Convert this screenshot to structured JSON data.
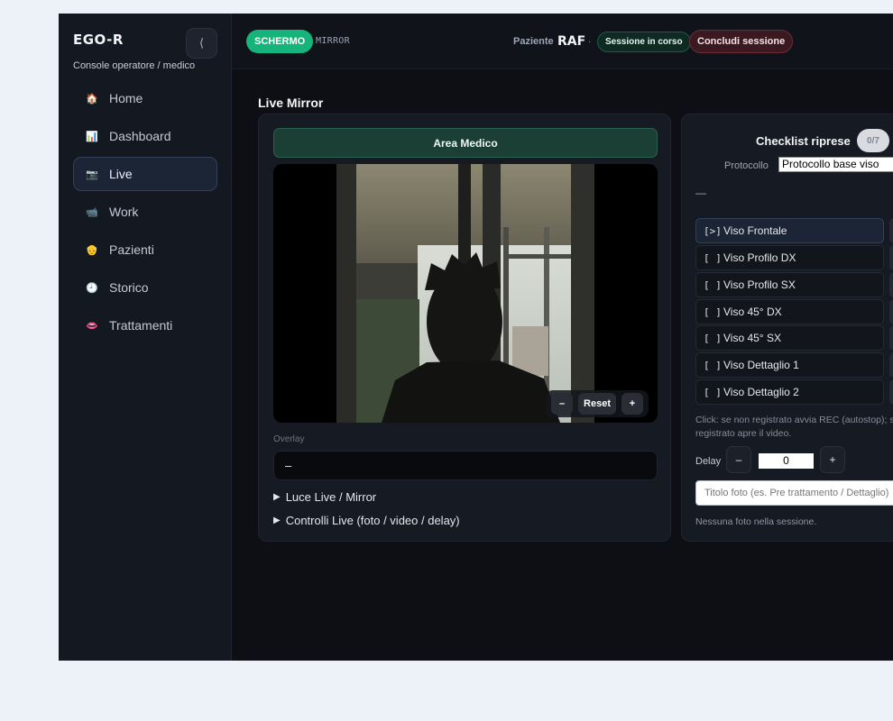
{
  "brand": {
    "name": "EGO-R",
    "subtitle": "Console operatore / medico",
    "collapse_icon": "⟨"
  },
  "nav": [
    {
      "label": "Home",
      "icon": "home-icon",
      "glyph": "🏠"
    },
    {
      "label": "Dashboard",
      "icon": "chart-icon",
      "glyph": "📊"
    },
    {
      "label": "Live",
      "icon": "camera-icon",
      "glyph": "📷",
      "active": true
    },
    {
      "label": "Work",
      "icon": "video-camera-icon",
      "glyph": "📹"
    },
    {
      "label": "Pazienti",
      "icon": "person-icon",
      "glyph": "👴"
    },
    {
      "label": "Storico",
      "icon": "clock-icon",
      "glyph": "🕘"
    },
    {
      "label": "Trattamenti",
      "icon": "lips-icon",
      "glyph": "👄"
    }
  ],
  "topbar": {
    "screen_pill": "SCHERMO",
    "mirror_tab": "MIRROR",
    "patient_label": "Paziente",
    "patient_value": "RAF",
    "separator": "·",
    "session_badge": "Sessione in corso",
    "end_session": "Concludi sessione"
  },
  "live": {
    "title": "Live Mirror",
    "area_button": "Area Medico",
    "zoom": {
      "minus": "–",
      "reset": "Reset",
      "plus": "+"
    },
    "overlay_label": "Overlay",
    "overlay_value": "–",
    "details": [
      {
        "label": "Luce Live / Mirror"
      },
      {
        "label": "Controlli Live (foto / video / delay)"
      }
    ]
  },
  "checklist": {
    "title": "Checklist riprese",
    "count": "0/7",
    "protocol_label": "Protocollo",
    "protocol_value": "Protocollo base viso",
    "dash": "—",
    "shots": [
      {
        "mark": "[>]",
        "label": "Viso Frontale",
        "current": true
      },
      {
        "mark": "[ ]",
        "label": "Viso Profilo DX"
      },
      {
        "mark": "[ ]",
        "label": "Viso Profilo SX"
      },
      {
        "mark": "[ ]",
        "label": "Viso 45° DX"
      },
      {
        "mark": "[ ]",
        "label": "Viso 45° SX"
      },
      {
        "mark": "[ ]",
        "label": "Viso Dettaglio 1"
      },
      {
        "mark": "[ ]",
        "label": "Viso Dettaglio 2"
      }
    ],
    "hint": "Click: se non registrato avvia REC (autostop); se registrato apre il video.",
    "delay_label": "Delay",
    "delay_minus": "–",
    "delay_value": "0",
    "delay_plus": "+",
    "photo_title_placeholder": "Titolo foto (es. Pre trattamento / Dettaglio)",
    "no_photos": "Nessuna foto nella sessione."
  }
}
